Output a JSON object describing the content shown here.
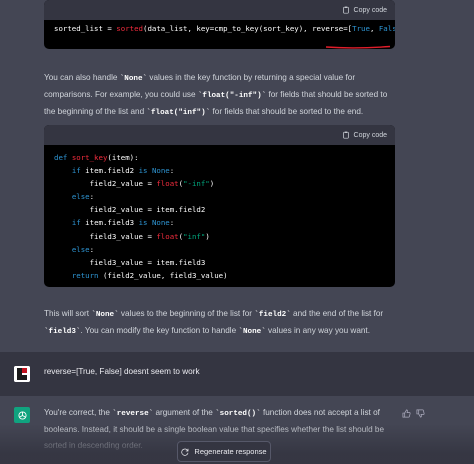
{
  "code_block_1": {
    "copy_label": "Copy code",
    "line": {
      "p1": "sorted_list = ",
      "p2": "sorted",
      "p3": "(data_list, key=cmp_to_key(sort_key), reverse=[",
      "p4": "True",
      "p5": ", ",
      "p6": "False",
      "p7": "])"
    }
  },
  "para_1": {
    "t1": "You can also handle ",
    "c1": "`None`",
    "t2": " values in the key function by returning a special value for comparisons. For example, you could use ",
    "c2": "`float(\"-inf\")`",
    "t3": " for fields that should be sorted to the beginning of the list and ",
    "c3": "`float(\"inf\")`",
    "t4": " for fields that should be sorted to the end."
  },
  "code_block_2": {
    "copy_label": "Copy code",
    "l1": {
      "kw": "def ",
      "fn": "sort_key",
      "rest": "(item):"
    },
    "l2": {
      "kw": "if ",
      "rest": "item.field2 ",
      "kw2": "is ",
      "kw3": "None",
      "end": ":"
    },
    "l3": {
      "rest": "field2_value = ",
      "fn": "float",
      "p": "(",
      "str": "\"-inf\"",
      "end": ")"
    },
    "l4": {
      "kw": "else",
      "end": ":"
    },
    "l5": {
      "rest": "field2_value = item.field2"
    },
    "l6": {
      "kw": "if ",
      "rest": "item.field3 ",
      "kw2": "is ",
      "kw3": "None",
      "end": ":"
    },
    "l7": {
      "rest": "field3_value = ",
      "fn": "float",
      "p": "(",
      "str": "\"inf\"",
      "end": ")"
    },
    "l8": {
      "kw": "else",
      "end": ":"
    },
    "l9": {
      "rest": "field3_value = item.field3"
    },
    "l10": {
      "kw": "return ",
      "rest": "(field2_value, field3_value)"
    }
  },
  "para_2": {
    "t1": "This will sort ",
    "c1": "`None`",
    "t2": " values to the beginning of the list for ",
    "c2": "`field2`",
    "t3": " and the end of the list for ",
    "c3": "`field3`",
    "t4": ". You can modify the key function to handle ",
    "c4": "`None`",
    "t5": " values in any way you want."
  },
  "user_message": "reverse=[True, False] doesnt seem to work",
  "assistant_reply": {
    "t1": "You're correct, the ",
    "c1": "`reverse`",
    "t2": " argument of the ",
    "c2": "`sorted()`",
    "t3": " function does not accept a list of booleans. Instead, it should be a single boolean value that specifies whether the list should be sorted in descending order."
  },
  "regenerate_label": "Regenerate response",
  "colors": {
    "assistant_bg": "#444654",
    "user_bg": "#343541",
    "accent_green": "#10a37f",
    "keyword": "#2e95d3",
    "function": "#f22c3d",
    "string": "#00a67d"
  }
}
